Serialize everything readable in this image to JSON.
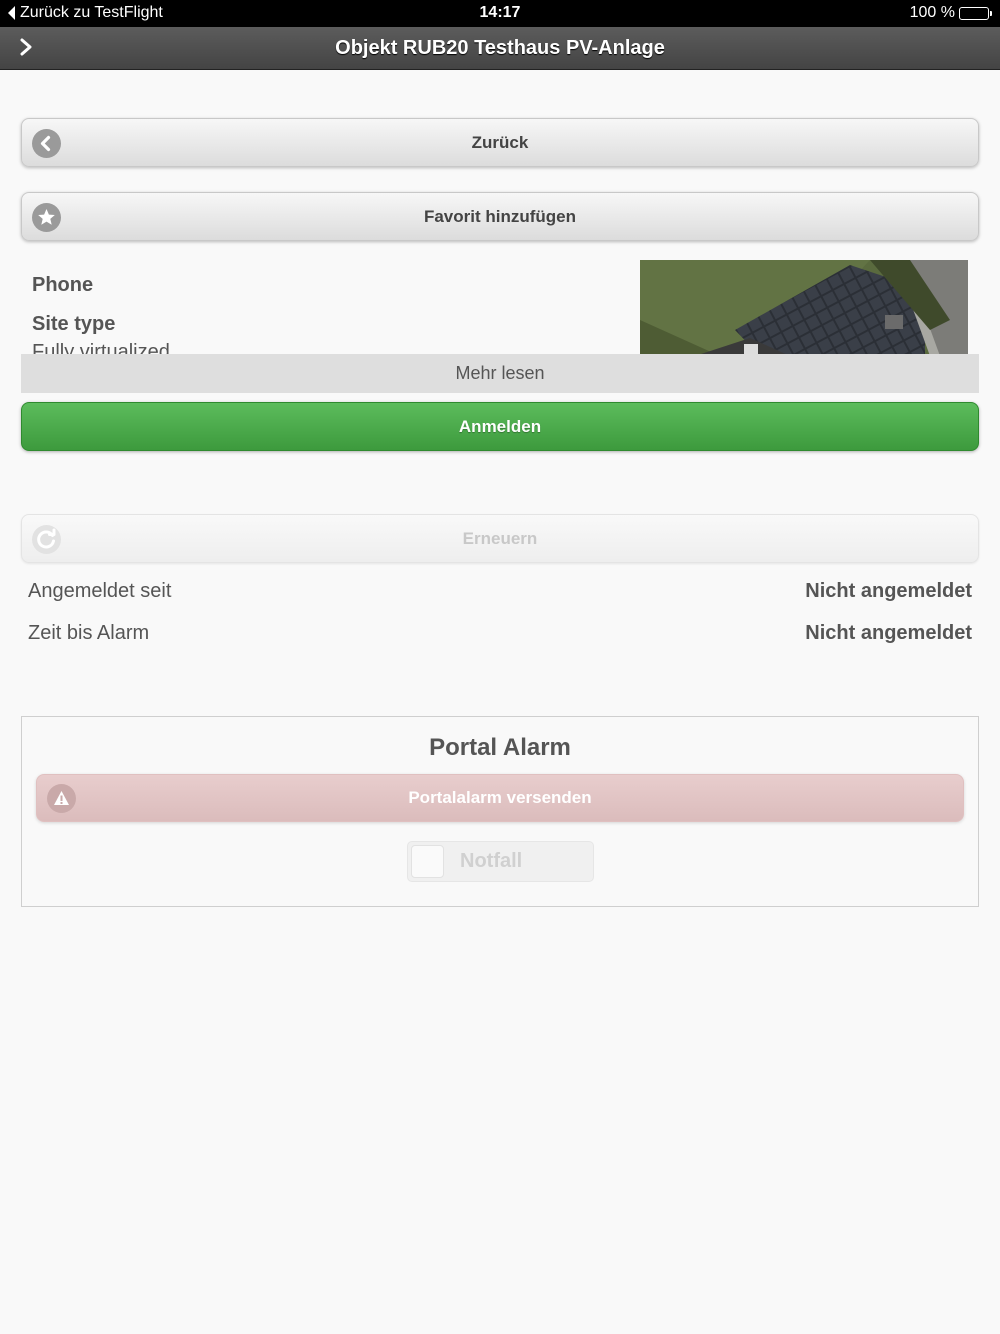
{
  "statusbar": {
    "back_label": "Zurück zu TestFlight",
    "time": "14:17",
    "battery": "100 %",
    "battery_level": 1.0
  },
  "navbar": {
    "title": "Objekt RUB20 Testhaus PV-Anlage",
    "icon": "chevron-right-icon"
  },
  "buttons": {
    "back_label": "Zurück",
    "back_icon": "chevron-left-circle-icon",
    "favorite_label": "Favorit hinzufügen",
    "favorite_icon": "star-icon",
    "login_label": "Anmelden",
    "renew_label": "Erneuern",
    "renew_icon": "refresh-icon"
  },
  "info": {
    "phone_label": "Phone",
    "site_type_label": "Site type",
    "site_type_value": "Fully virtualized",
    "more_label": "Mehr lesen"
  },
  "status": {
    "logged_in_since_label": "Angemeldet seit",
    "logged_in_since_value": "Nicht angemeldet",
    "time_to_alarm_label": "Zeit bis Alarm",
    "time_to_alarm_value": "Nicht angemeldet"
  },
  "portal_alarm": {
    "title": "Portal Alarm",
    "send_label": "Portalalarm versenden",
    "send_icon": "warning-icon",
    "emergency_label": "Notfall"
  },
  "colors": {
    "navbar": "#4f4f4f",
    "login_green": "#4aab4a",
    "alarm_red": "#e2c4c4"
  }
}
